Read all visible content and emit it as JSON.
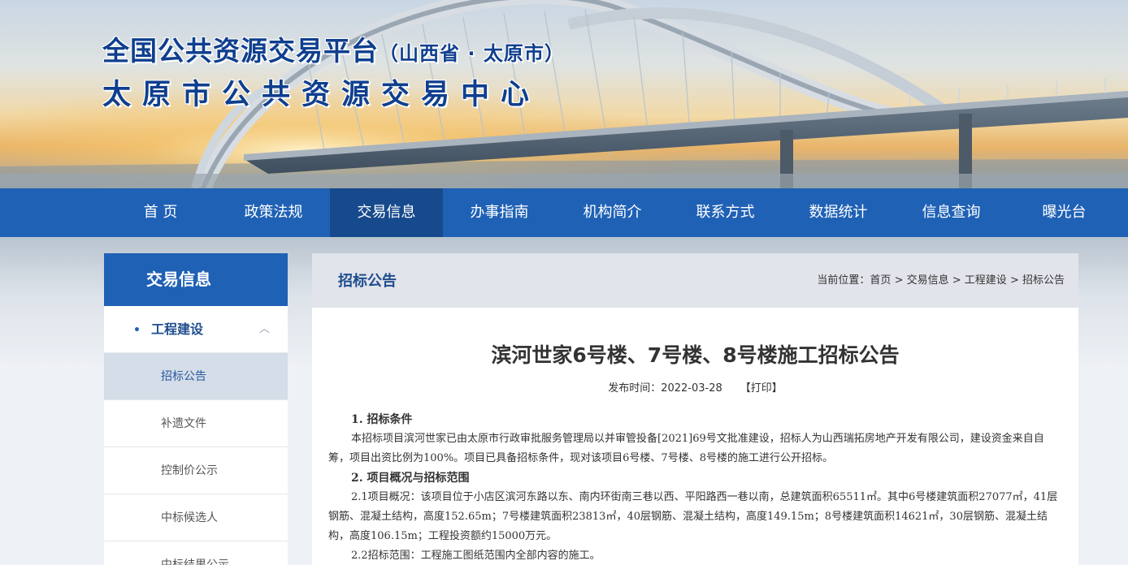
{
  "header": {
    "platform_title": "全国公共资源交易平台",
    "platform_region": "（山西省 · 太原市）",
    "center_name": "太原市公共资源交易中心"
  },
  "nav": {
    "items": [
      "首 页",
      "政策法规",
      "交易信息",
      "办事指南",
      "机构简介",
      "联系方式",
      "数据统计",
      "信息查询",
      "曝光台"
    ],
    "active": "交易信息"
  },
  "sidebar": {
    "title": "交易信息",
    "category": {
      "bullet": "•",
      "label": "工程建设",
      "chevron": "︿"
    },
    "items": [
      "招标公告",
      "补遗文件",
      "控制价公示",
      "中标候选人",
      "中标结果公示"
    ],
    "active": "招标公告"
  },
  "main": {
    "section": "招标公告",
    "breadcrumb": {
      "prefix": "当前位置：",
      "items": [
        "首页",
        "交易信息",
        "工程建设",
        "招标公告"
      ],
      "separator": " > "
    },
    "article": {
      "title": "滨河世家6号楼、7号楼、8号楼施工招标公告",
      "publish_label": "发布时间：",
      "publish_date": "2022-03-28",
      "print_label": "【打印】",
      "sections": [
        {
          "heading": "1. 招标条件",
          "paragraphs": [
            "本招标项目滨河世家已由太原市行政审批服务管理局以并审管投备[2021]69号文批准建设，招标人为山西瑞拓房地产开发有限公司，建设资金来自自筹，项目出资比例为100%。项目已具备招标条件，现对该项目6号楼、7号楼、8号楼的施工进行公开招标。"
          ]
        },
        {
          "heading": "2. 项目概况与招标范围",
          "paragraphs": [
            "2.1项目概况：该项目位于小店区滨河东路以东、南内环街南三巷以西、平阳路西一巷以南，总建筑面积65511㎡。其中6号楼建筑面积27077㎡，41层钢筋、混凝土结构，高度152.65m；7号楼建筑面积23813㎡，40层钢筋、混凝土结构，高度149.15m；8号楼建筑面积14621㎡，30层钢筋、混凝土结构，高度106.15m；工程投资额约15000万元。",
            "2.2招标范围：工程施工图纸范围内全部内容的施工。"
          ]
        }
      ]
    }
  },
  "colors": {
    "nav_bg": "#1f61b5",
    "nav_active": "#174a8c",
    "title_blue": "#0f3f8e"
  }
}
